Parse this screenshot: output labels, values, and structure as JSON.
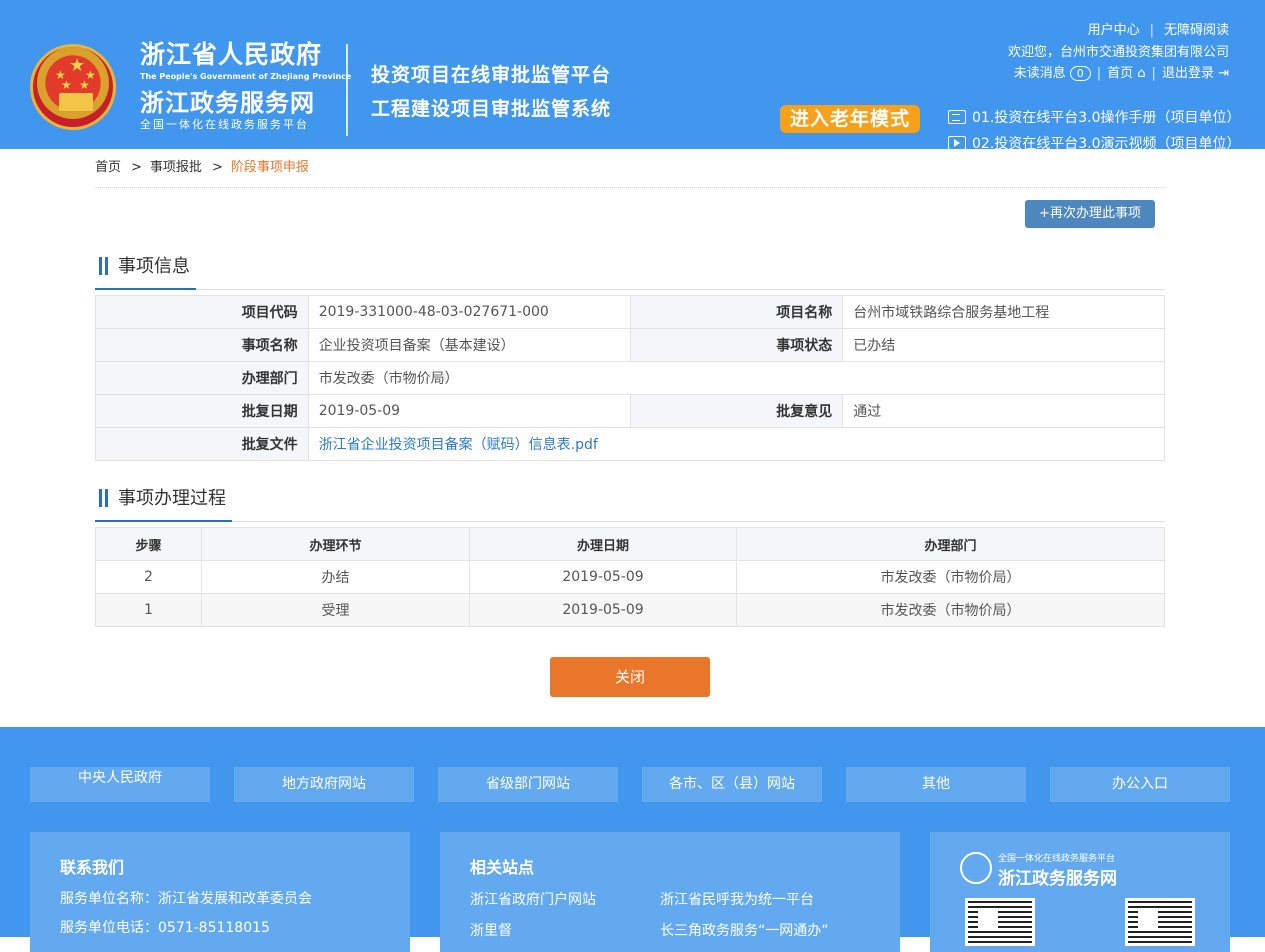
{
  "header": {
    "gov_name": "浙江省人民政府",
    "gov_name_en": "The People's Government of Zhejiang Province",
    "service_name": "浙江政务服务网",
    "service_sub": "全国一体化在线政务服务平台",
    "system_title_1": "投资项目在线审批监管平台",
    "system_title_2": "工程建设项目审批监管系统",
    "user_center": "用户中心",
    "accessible": "无障碍阅读",
    "welcome": "欢迎您，台州市交通投资集团有限公司",
    "unread_label": "未读消息",
    "unread_count": "0",
    "home": "首页",
    "logout": "退出登录",
    "elder_mode": "进入老年模式",
    "manual_1": "01.投资在线平台3.0操作手册（项目单位）",
    "manual_2": "02.投资在线平台3.0演示视频（项目单位）"
  },
  "breadcrumb": {
    "home": "首页",
    "level2": "事项报批",
    "current": "阶段事项申报",
    "sep": ">"
  },
  "actions": {
    "again": "+再次办理此事项",
    "close": "关闭"
  },
  "info": {
    "title": "事项信息",
    "project_code_label": "项目代码",
    "project_code": "2019-331000-48-03-027671-000",
    "project_name_label": "项目名称",
    "project_name": "台州市域铁路综合服务基地工程",
    "item_name_label": "事项名称",
    "item_name": "企业投资项目备案（基本建设）",
    "item_status_label": "事项状态",
    "item_status": "已办结",
    "dept_label": "办理部门",
    "dept": "市发改委（市物价局）",
    "approve_date_label": "批复日期",
    "approve_date": "2019-05-09",
    "approve_opinion_label": "批复意见",
    "approve_opinion": "通过",
    "approve_file_label": "批复文件",
    "approve_file": "浙江省企业投资项目备案（赋码）信息表.pdf"
  },
  "process": {
    "title": "事项办理过程",
    "headers": [
      "步骤",
      "办理环节",
      "办理日期",
      "办理部门"
    ],
    "rows": [
      [
        "2",
        "办结",
        "2019-05-09",
        "市发改委（市物价局）"
      ],
      [
        "1",
        "受理",
        "2019-05-09",
        "市发改委（市物价局）"
      ]
    ]
  },
  "footer": {
    "nav": [
      "中央人民政府",
      "地方政府网站",
      "省级部门网站",
      "各市、区（县）网站",
      "其他",
      "办公入口"
    ],
    "contact_title": "联系我们",
    "contact_unit": "服务单位名称：浙江省发展和改革委员会",
    "contact_phone": "服务单位电话：0571-85118015",
    "related_title": "相关站点",
    "related": [
      "浙江省政府门户网站",
      "浙江省民呼我为统一平台",
      "浙里督",
      "长三角政务服务“一网通办”"
    ],
    "zw_sub": "全国一体化在线政务服务平台",
    "zw_name": "浙江政务服务网"
  },
  "colors": {
    "header_bg": "#4196ee",
    "accent_orange": "#e9762b",
    "elder_orange": "#f7a11a",
    "section_blue": "#2d6fb3"
  }
}
